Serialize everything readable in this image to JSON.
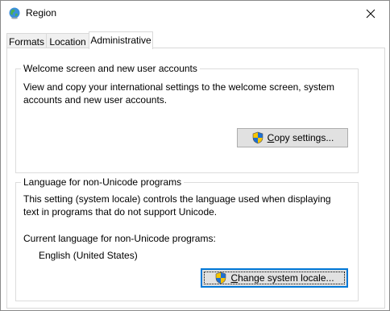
{
  "window": {
    "title": "Region",
    "icon": "globe-icon",
    "close_icon": "close-icon"
  },
  "tabs": [
    {
      "label": "Formats",
      "active": false
    },
    {
      "label": "Location",
      "active": false
    },
    {
      "label": "Administrative",
      "active": true
    }
  ],
  "welcome_group": {
    "legend": "Welcome screen and new user accounts",
    "description_line1": "View and copy your international settings to the welcome screen, system",
    "description_line2": "accounts and new user accounts.",
    "button": {
      "label_mnemonic": "C",
      "label_rest": "opy settings...",
      "icon": "uac-shield-icon"
    }
  },
  "nonunicode_group": {
    "legend": "Language for non-Unicode programs",
    "description_line1": "This setting (system locale) controls the language used when displaying",
    "description_line2": "text in programs that do not support Unicode.",
    "current_label": "Current language for non-Unicode programs:",
    "current_value": "English (United States)",
    "button": {
      "label_mnemonic": "C",
      "label_rest": "hange system locale...",
      "icon": "uac-shield-icon"
    }
  }
}
